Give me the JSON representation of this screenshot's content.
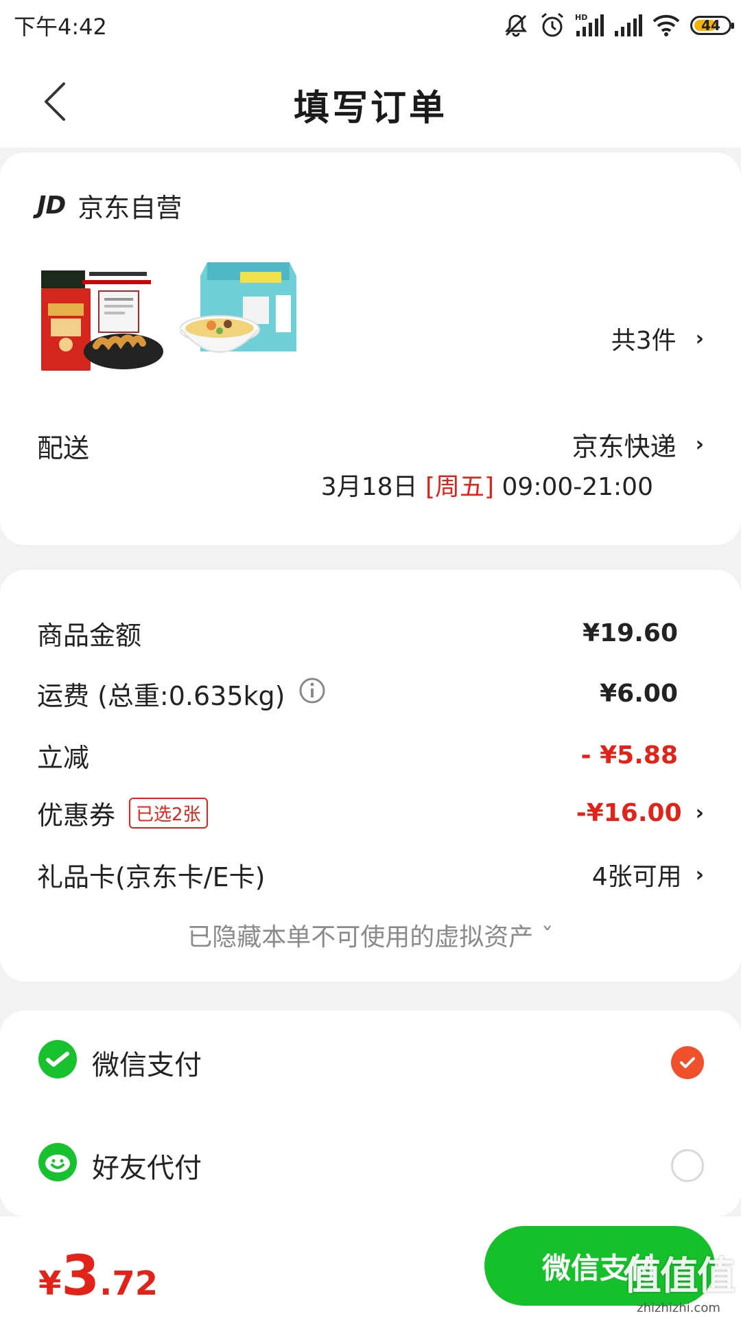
{
  "status_bar": {
    "time": "下午4:42",
    "battery": "44"
  },
  "header": {
    "title": "填写订单"
  },
  "order": {
    "shop_logo": "JD",
    "shop_name": "京东自营",
    "items_count": "共3件",
    "delivery_label": "配送",
    "delivery_method": "京东快递",
    "delivery_date": "3月18日 ",
    "delivery_weekday": "[周五]",
    "delivery_hours": " 09:00-21:00"
  },
  "fees": {
    "goods_label": "商品金额",
    "goods_value": "¥19.60",
    "shipping_label": "运费 (总重:0.635kg)",
    "shipping_value": "¥6.00",
    "discount_label": "立减",
    "discount_value": "- ¥5.88",
    "coupon_label": "优惠券",
    "coupon_badge": "已选2张",
    "coupon_value": "-¥16.00",
    "giftcard_label": "礼品卡(京东卡/E卡)",
    "giftcard_value": "4张可用",
    "hidden_assets": "已隐藏本单不可使用的虚拟资产 ˇ"
  },
  "payment": {
    "wechat_label": "微信支付",
    "wechat_selected": true,
    "friend_label": "好友代付",
    "friend_selected": false
  },
  "bottom": {
    "total_currency": "¥",
    "total_int": "3",
    "total_dec": ".72",
    "pay_button": "微信支付",
    "watermark_main": "值值值",
    "watermark_sub": "zhizhizhi.com"
  },
  "colors": {
    "accent_red": "#e2231a",
    "wechat_green": "#15c02a",
    "radio_orange": "#f0502c"
  },
  "icons": [
    "back-icon",
    "mute-icon",
    "alarm-icon",
    "signal-icon",
    "wifi-icon",
    "battery-icon",
    "chevron-right-icon",
    "info-icon",
    "wechat-pay-icon",
    "friend-pay-icon",
    "check-icon"
  ]
}
